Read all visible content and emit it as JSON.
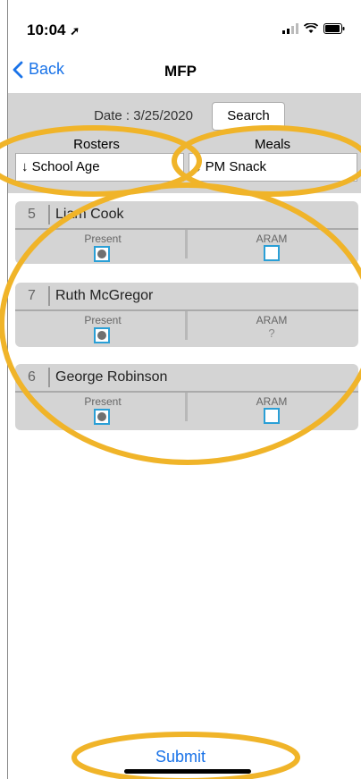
{
  "status_bar": {
    "time": "10:04"
  },
  "nav": {
    "back_label": "Back",
    "title": "MFP"
  },
  "filters": {
    "date_label": "Date : 3/25/2020",
    "search_label": "Search",
    "rosters_label": "Rosters",
    "meals_label": "Meals",
    "roster_value": "↓ School Age",
    "meal_value": "↓ PM Snack"
  },
  "students": [
    {
      "number": "5",
      "name": "Liam Cook",
      "present_label": "Present",
      "present_checked": true,
      "aram_label": "ARAM",
      "aram_state": "checkbox"
    },
    {
      "number": "7",
      "name": "Ruth McGregor",
      "present_label": "Present",
      "present_checked": true,
      "aram_label": "ARAM",
      "aram_state": "?"
    },
    {
      "number": "6",
      "name": "George Robinson",
      "present_label": "Present",
      "present_checked": true,
      "aram_label": "ARAM",
      "aram_state": "checkbox"
    }
  ],
  "submit_label": "Submit",
  "colors": {
    "accent": "#1a73e8",
    "annotation": "#f0b429",
    "panel": "#d4d4d4",
    "checkbox_border": "#2a9fd6"
  }
}
